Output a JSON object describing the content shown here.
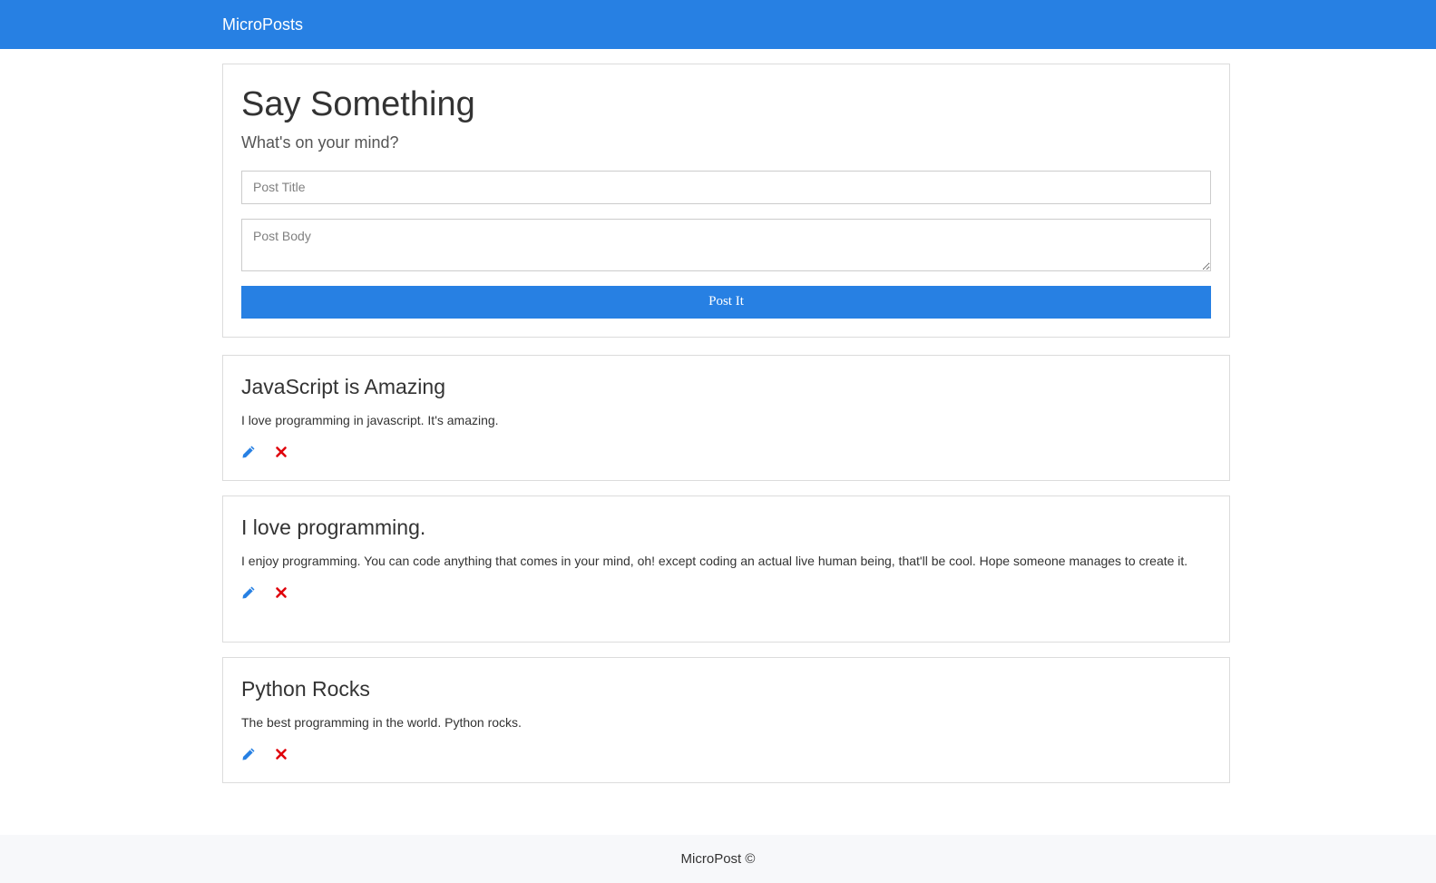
{
  "app": {
    "brand": "MicroPosts"
  },
  "form": {
    "heading": "Say Something",
    "subheading": "What's on your mind?",
    "title_placeholder": "Post Title",
    "title_value": "",
    "body_placeholder": "Post Body",
    "body_value": "",
    "submit_label": "Post It"
  },
  "posts": [
    {
      "title": "JavaScript is Amazing",
      "body": "I love programming in javascript. It's amazing.",
      "edit_icon": "pencil-icon",
      "delete_icon": "remove-icon"
    },
    {
      "title": "I love programming.",
      "body": "I enjoy programming. You can code anything that comes in your mind, oh! except coding an actual live human being, that'll be cool. Hope someone manages to create it.",
      "edit_icon": "pencil-icon",
      "delete_icon": "remove-icon"
    },
    {
      "title": "Python Rocks",
      "body": "The best programming in the world. Python rocks.",
      "edit_icon": "pencil-icon",
      "delete_icon": "remove-icon"
    }
  ],
  "footer": {
    "text": "MicroPost ©"
  },
  "colors": {
    "primary": "#2780e3",
    "danger": "#e0000a",
    "footer_bg": "#f7f8fa"
  }
}
